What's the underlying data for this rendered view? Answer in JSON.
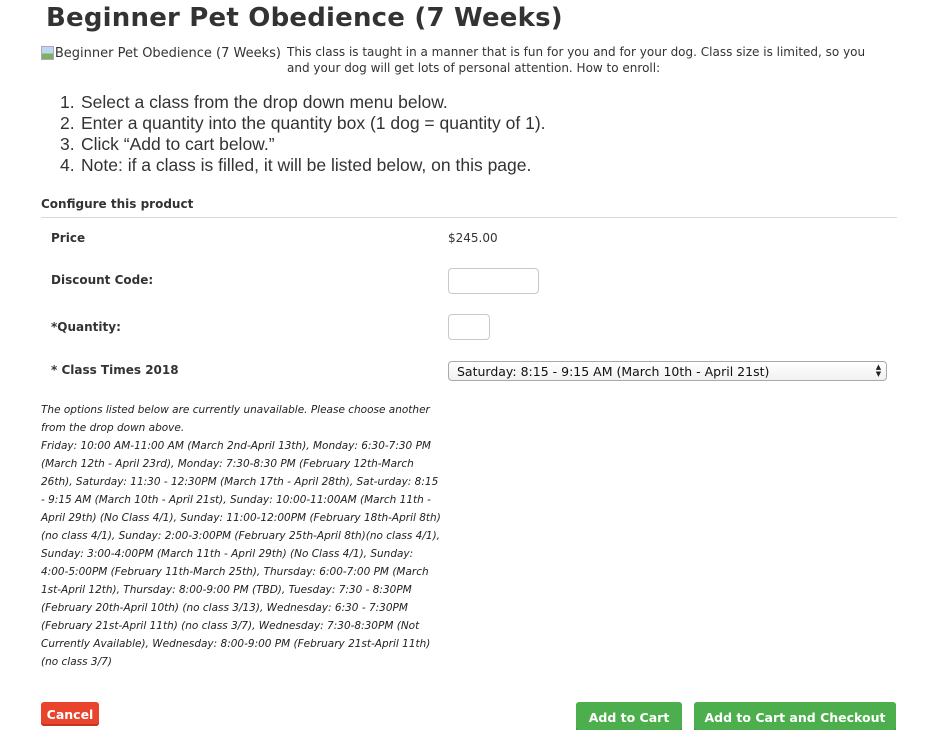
{
  "product": {
    "title": "Beginner Pet Obedience (7 Weeks)",
    "image_alt": "Beginner Pet Obedience (7 Weeks)",
    "description": "This class is taught in a manner that is fun for you and for your dog. Class size is limited, so you and your dog will get lots of personal attention. How to enroll:"
  },
  "steps": [
    {
      "num": "1.",
      "text": "Select a class from the drop down menu below."
    },
    {
      "num": "2.",
      "text": "Enter a quantity into the quantity box (1 dog = quantity of 1)."
    },
    {
      "num": "3.",
      "text": "Click “Add to cart below.”"
    },
    {
      "num": "4.",
      "text": "Note: if a class is filled, it will be listed below, on this page."
    }
  ],
  "configure": {
    "heading": "Configure this product",
    "price_label": "Price",
    "price_value": "$245.00",
    "discount_label": "Discount Code:",
    "discount_value": "",
    "quantity_label": "*Quantity:",
    "quantity_value": "",
    "class_times_label": "* Class Times 2018",
    "class_times_selected": "Saturday: 8:15 - 9:15 AM (March 10th - April 21st)"
  },
  "unavailable": {
    "intro": "The options listed below are currently unavailable. Please choose another from the drop down above.",
    "list": "Friday: 10:00 AM-11:00 AM (March 2nd-April 13th), Monday: 6:30-7:30 PM (March 12th - April 23rd), Monday: 7:30-8:30 PM (February 12th-March 26th), Saturday: 11:30 - 12:30PM (March 17th - April 28th), Sat-urday: 8:15 - 9:15 AM (March 10th - April 21st), Sunday: 10:00-11:00AM (March 11th - April 29th) (No Class 4/1), Sunday: 11:00-12:00PM (February 18th-April 8th)(no class 4/1), Sunday: 2:00-3:00PM (February 25th-April 8th)(no class 4/1), Sunday: 3:00-4:00PM (March 11th - April 29th) (No Class 4/1), Sunday: 4:00-5:00PM (February 11th-March 25th), Thursday: 6:00-7:00 PM (March 1st-April 12th), Thursday: 8:00-9:00 PM (TBD), Tuesday: 7:30 - 8:30PM (February 20th-April 10th) (no class 3/13), Wednesday: 6:30 - 7:30PM (February 21st-April 11th) (no class 3/7), Wednesday: 7:30-8:30PM (Not Currently Available), Wednesday: 8:00-9:00 PM (February 21st-April 11th)(no class 3/7)"
  },
  "actions": {
    "cancel_label": "Cancel",
    "add_to_cart_label": "Add to Cart",
    "add_checkout_label": "Add to Cart and Checkout"
  },
  "colors": {
    "cancel_button": "#e8452c",
    "cart_buttons": "#4cae4c",
    "text": "#333333"
  }
}
